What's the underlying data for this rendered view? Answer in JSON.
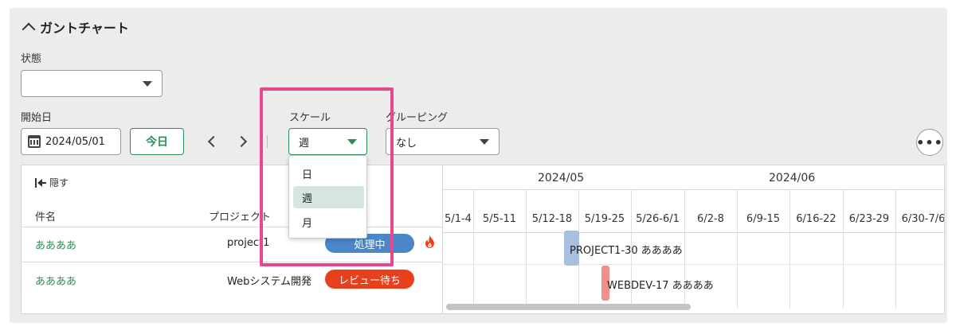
{
  "section": {
    "title": "ガントチャート"
  },
  "filters": {
    "status_label": "状態",
    "status_value": "",
    "start_label": "開始日",
    "start_value": "2024/05/01",
    "today_label": "今日",
    "scale_label": "スケール",
    "scale_value": "週",
    "scale_options": [
      "日",
      "週",
      "月"
    ],
    "grouping_label": "グルーピング",
    "grouping_value": "なし"
  },
  "table": {
    "hide_label": "隠す",
    "columns": [
      "件名",
      "プロジェクト"
    ],
    "rows": [
      {
        "name": "ああああ",
        "project": "project1",
        "status": "処理中",
        "status_color": "#4a86c8"
      },
      {
        "name": "ああああ",
        "project": "Webシステム開発",
        "status": "レビュー待ち",
        "status_color": "#e8401c"
      }
    ]
  },
  "gantt": {
    "months": [
      "2024/05",
      "2024/06"
    ],
    "weeks": [
      "5/1-4",
      "5/5-11",
      "5/12-18",
      "5/19-25",
      "5/26-6/1",
      "6/2-8",
      "6/9-15",
      "6/16-22",
      "6/23-29",
      "6/30-7/6"
    ],
    "bars": [
      {
        "label": "PROJECT1-30 ああああ",
        "color": "#a8c0e0"
      },
      {
        "label": "WEBDEV-17 ああああ",
        "color": "#f0908a"
      }
    ]
  },
  "colors": {
    "accent": "#2e8b57",
    "highlight": "#e8478f"
  }
}
